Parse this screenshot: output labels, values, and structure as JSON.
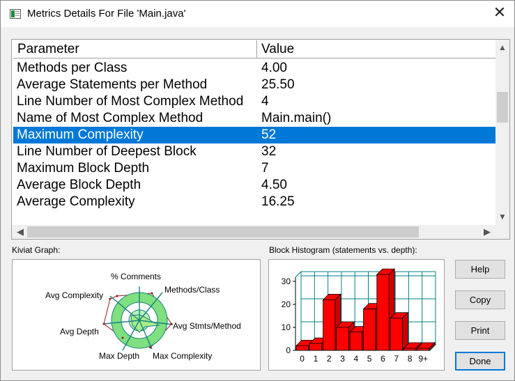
{
  "window": {
    "title": "Metrics Details For File 'Main.java'",
    "close_glyph": "✕"
  },
  "table": {
    "columns": [
      "Parameter",
      "Value"
    ],
    "rows": [
      {
        "parameter": "Methods per Class",
        "value": "4.00"
      },
      {
        "parameter": "Average Statements per Method",
        "value": "25.50"
      },
      {
        "parameter": "Line Number of Most Complex Method",
        "value": "4"
      },
      {
        "parameter": "Name of Most Complex Method",
        "value": "Main.main()"
      },
      {
        "parameter": "Maximum Complexity",
        "value": "52",
        "selected": true
      },
      {
        "parameter": "Line Number of Deepest Block",
        "value": "32"
      },
      {
        "parameter": "Maximum Block Depth",
        "value": "7"
      },
      {
        "parameter": "Average Block Depth",
        "value": "4.50"
      },
      {
        "parameter": "Average Complexity",
        "value": "16.25"
      }
    ],
    "selection_color": "#0078d7"
  },
  "kiviat": {
    "label": "Kiviat Graph:",
    "axes": [
      "% Comments",
      "Methods/Class",
      "Avg Stmts/Method",
      "Max Complexity",
      "Max Depth",
      "Avg Depth",
      "Avg Complexity"
    ]
  },
  "histogram": {
    "label": "Block Histogram (statements vs. depth):",
    "bar_color": "#ff0000",
    "grid_color": "#008080"
  },
  "buttons": {
    "help": "Help",
    "copy": "Copy",
    "print": "Print",
    "done": "Done"
  },
  "chart_data": [
    {
      "type": "bar",
      "title": "",
      "xlabel": "",
      "ylabel": "",
      "categories": [
        "0",
        "1",
        "2",
        "3",
        "4",
        "5",
        "6",
        "7",
        "8",
        "9+"
      ],
      "values": [
        2,
        3,
        22,
        10,
        8,
        18,
        33,
        14,
        0,
        0
      ],
      "ylim": [
        0,
        30
      ],
      "yticks": [
        "0",
        "10",
        "20",
        "30"
      ],
      "grid": true
    }
  ]
}
